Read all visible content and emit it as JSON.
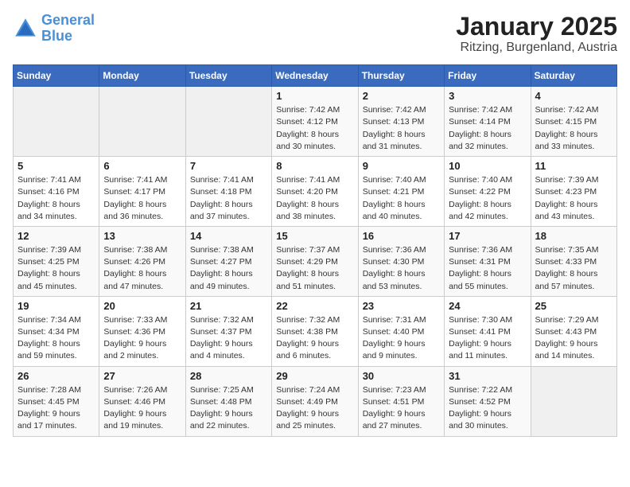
{
  "logo": {
    "text1": "General",
    "text2": "Blue"
  },
  "title": "January 2025",
  "subtitle": "Ritzing, Burgenland, Austria",
  "days_of_week": [
    "Sunday",
    "Monday",
    "Tuesday",
    "Wednesday",
    "Thursday",
    "Friday",
    "Saturday"
  ],
  "weeks": [
    [
      {
        "day": "",
        "info": ""
      },
      {
        "day": "",
        "info": ""
      },
      {
        "day": "",
        "info": ""
      },
      {
        "day": "1",
        "info": "Sunrise: 7:42 AM\nSunset: 4:12 PM\nDaylight: 8 hours\nand 30 minutes."
      },
      {
        "day": "2",
        "info": "Sunrise: 7:42 AM\nSunset: 4:13 PM\nDaylight: 8 hours\nand 31 minutes."
      },
      {
        "day": "3",
        "info": "Sunrise: 7:42 AM\nSunset: 4:14 PM\nDaylight: 8 hours\nand 32 minutes."
      },
      {
        "day": "4",
        "info": "Sunrise: 7:42 AM\nSunset: 4:15 PM\nDaylight: 8 hours\nand 33 minutes."
      }
    ],
    [
      {
        "day": "5",
        "info": "Sunrise: 7:41 AM\nSunset: 4:16 PM\nDaylight: 8 hours\nand 34 minutes."
      },
      {
        "day": "6",
        "info": "Sunrise: 7:41 AM\nSunset: 4:17 PM\nDaylight: 8 hours\nand 36 minutes."
      },
      {
        "day": "7",
        "info": "Sunrise: 7:41 AM\nSunset: 4:18 PM\nDaylight: 8 hours\nand 37 minutes."
      },
      {
        "day": "8",
        "info": "Sunrise: 7:41 AM\nSunset: 4:20 PM\nDaylight: 8 hours\nand 38 minutes."
      },
      {
        "day": "9",
        "info": "Sunrise: 7:40 AM\nSunset: 4:21 PM\nDaylight: 8 hours\nand 40 minutes."
      },
      {
        "day": "10",
        "info": "Sunrise: 7:40 AM\nSunset: 4:22 PM\nDaylight: 8 hours\nand 42 minutes."
      },
      {
        "day": "11",
        "info": "Sunrise: 7:39 AM\nSunset: 4:23 PM\nDaylight: 8 hours\nand 43 minutes."
      }
    ],
    [
      {
        "day": "12",
        "info": "Sunrise: 7:39 AM\nSunset: 4:25 PM\nDaylight: 8 hours\nand 45 minutes."
      },
      {
        "day": "13",
        "info": "Sunrise: 7:38 AM\nSunset: 4:26 PM\nDaylight: 8 hours\nand 47 minutes."
      },
      {
        "day": "14",
        "info": "Sunrise: 7:38 AM\nSunset: 4:27 PM\nDaylight: 8 hours\nand 49 minutes."
      },
      {
        "day": "15",
        "info": "Sunrise: 7:37 AM\nSunset: 4:29 PM\nDaylight: 8 hours\nand 51 minutes."
      },
      {
        "day": "16",
        "info": "Sunrise: 7:36 AM\nSunset: 4:30 PM\nDaylight: 8 hours\nand 53 minutes."
      },
      {
        "day": "17",
        "info": "Sunrise: 7:36 AM\nSunset: 4:31 PM\nDaylight: 8 hours\nand 55 minutes."
      },
      {
        "day": "18",
        "info": "Sunrise: 7:35 AM\nSunset: 4:33 PM\nDaylight: 8 hours\nand 57 minutes."
      }
    ],
    [
      {
        "day": "19",
        "info": "Sunrise: 7:34 AM\nSunset: 4:34 PM\nDaylight: 8 hours\nand 59 minutes."
      },
      {
        "day": "20",
        "info": "Sunrise: 7:33 AM\nSunset: 4:36 PM\nDaylight: 9 hours\nand 2 minutes."
      },
      {
        "day": "21",
        "info": "Sunrise: 7:32 AM\nSunset: 4:37 PM\nDaylight: 9 hours\nand 4 minutes."
      },
      {
        "day": "22",
        "info": "Sunrise: 7:32 AM\nSunset: 4:38 PM\nDaylight: 9 hours\nand 6 minutes."
      },
      {
        "day": "23",
        "info": "Sunrise: 7:31 AM\nSunset: 4:40 PM\nDaylight: 9 hours\nand 9 minutes."
      },
      {
        "day": "24",
        "info": "Sunrise: 7:30 AM\nSunset: 4:41 PM\nDaylight: 9 hours\nand 11 minutes."
      },
      {
        "day": "25",
        "info": "Sunrise: 7:29 AM\nSunset: 4:43 PM\nDaylight: 9 hours\nand 14 minutes."
      }
    ],
    [
      {
        "day": "26",
        "info": "Sunrise: 7:28 AM\nSunset: 4:45 PM\nDaylight: 9 hours\nand 17 minutes."
      },
      {
        "day": "27",
        "info": "Sunrise: 7:26 AM\nSunset: 4:46 PM\nDaylight: 9 hours\nand 19 minutes."
      },
      {
        "day": "28",
        "info": "Sunrise: 7:25 AM\nSunset: 4:48 PM\nDaylight: 9 hours\nand 22 minutes."
      },
      {
        "day": "29",
        "info": "Sunrise: 7:24 AM\nSunset: 4:49 PM\nDaylight: 9 hours\nand 25 minutes."
      },
      {
        "day": "30",
        "info": "Sunrise: 7:23 AM\nSunset: 4:51 PM\nDaylight: 9 hours\nand 27 minutes."
      },
      {
        "day": "31",
        "info": "Sunrise: 7:22 AM\nSunset: 4:52 PM\nDaylight: 9 hours\nand 30 minutes."
      },
      {
        "day": "",
        "info": ""
      }
    ]
  ]
}
